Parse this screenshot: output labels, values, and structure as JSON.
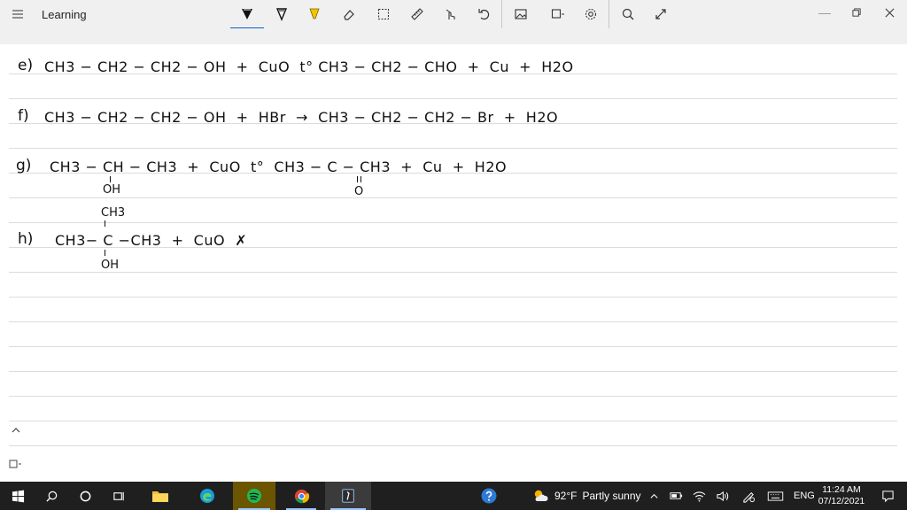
{
  "app": {
    "title": "Learning"
  },
  "toolbar": {
    "tools": [
      {
        "name": "ballpoint-pen",
        "selected": true
      },
      {
        "name": "pencil",
        "selected": false
      },
      {
        "name": "highlighter",
        "selected": false
      },
      {
        "name": "eraser",
        "selected": false
      },
      {
        "name": "lasso-select",
        "selected": false
      },
      {
        "name": "ruler",
        "selected": false
      },
      {
        "name": "touch-writing",
        "selected": false
      },
      {
        "name": "undo",
        "selected": false
      },
      {
        "name": "add-image",
        "selected": false
      },
      {
        "name": "add-page",
        "selected": false
      },
      {
        "name": "settings",
        "selected": false
      },
      {
        "name": "zoom",
        "selected": false
      },
      {
        "name": "full-screen",
        "selected": false
      }
    ]
  },
  "equations": {
    "e": {
      "label": "e)",
      "text": "CH3 − CH2 − CH2 − OH  +  CuO  t° CH3 − CH2 − CHO  +  Cu  +  H2O"
    },
    "f": {
      "label": "f)",
      "text": "CH3 − CH2 − CH2 − OH  +  HBr  →  CH3 − CH2 − CH2 − Br  +  H2O"
    },
    "g": {
      "label": "g)",
      "text": "CH3 − CH − CH3  +  CuO  t°  CH3 − C − CH3  +  Cu  +  H2O",
      "sub_oh": "OH",
      "sub_o": "O"
    },
    "h": {
      "label": "h)",
      "text": "CH3− C −CH3  +  CuO  ✗",
      "top": "CH3",
      "bottom": "OH"
    }
  },
  "taskbar": {
    "weather": {
      "temp": "92°F",
      "condition": "Partly sunny"
    },
    "language": "ENG",
    "time": "11:24 AM",
    "date": "07/12/2021"
  },
  "colors": {
    "accent": "#0a64c8",
    "highlighter": "#f5c400",
    "spotify": "#1db954"
  }
}
